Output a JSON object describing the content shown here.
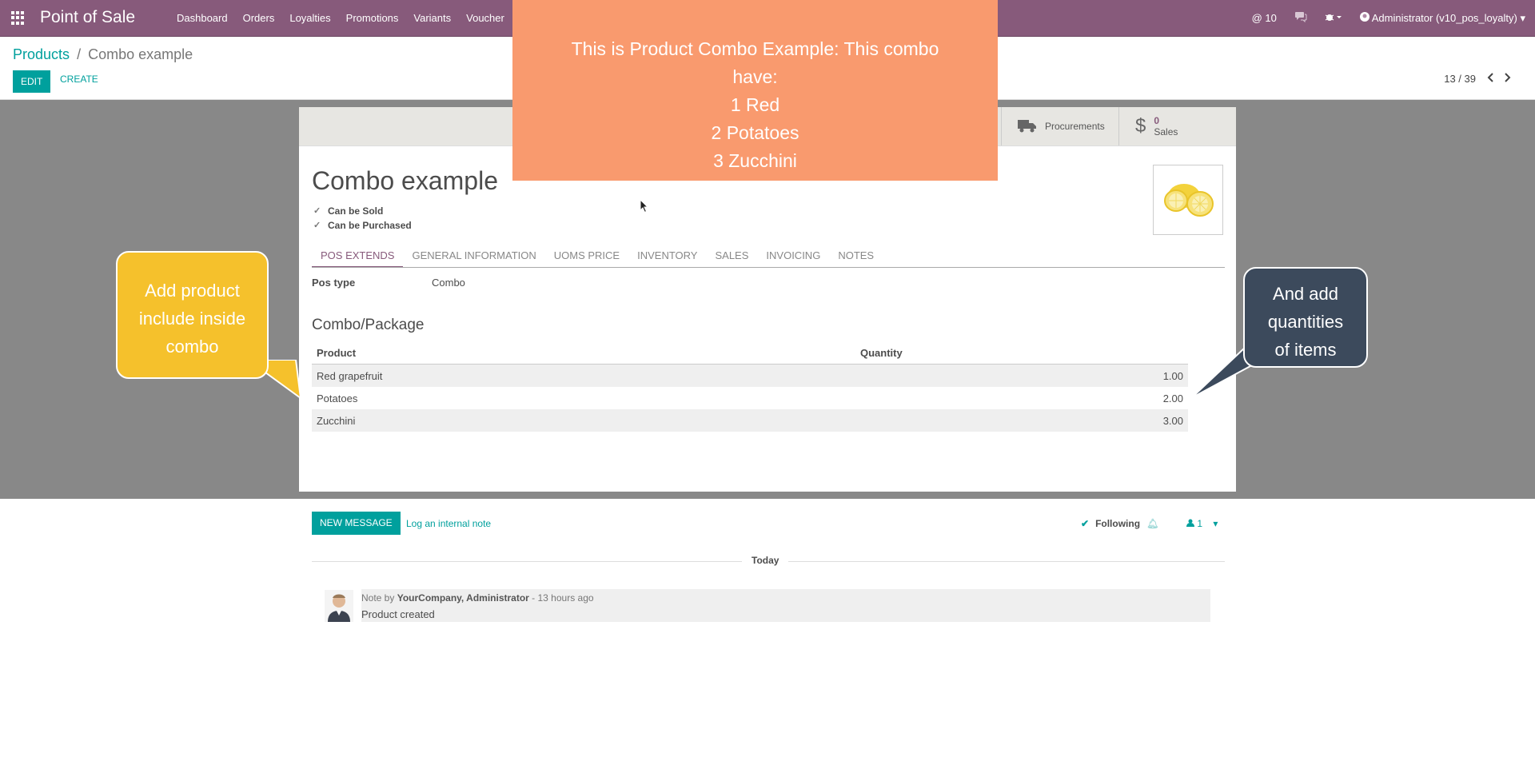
{
  "navbar": {
    "brand": "Point of Sale",
    "menu": [
      "Dashboard",
      "Orders",
      "Loyalties",
      "Promotions",
      "Variants",
      "Voucher"
    ],
    "mentions": "@ 10",
    "user": "Administrator (v10_pos_loyalty)"
  },
  "breadcrumb": {
    "parent": "Products",
    "separator": "/",
    "current": "Combo example"
  },
  "actions": {
    "edit": "EDIT",
    "create": "CREATE"
  },
  "pager": {
    "value": "13 / 39"
  },
  "stat_buttons": {
    "procurements": "Procurements",
    "sales_count": "0",
    "sales_label": "Sales"
  },
  "product": {
    "name": "Combo example",
    "can_be_sold": "Can be Sold",
    "can_be_purchased": "Can be Purchased",
    "image_alt": "lemons"
  },
  "tabs": [
    "POS EXTENDS",
    "GENERAL INFORMATION",
    "UOMS PRICE",
    "INVENTORY",
    "SALES",
    "INVOICING",
    "NOTES"
  ],
  "pos_type": {
    "label": "Pos type",
    "value": "Combo"
  },
  "combo": {
    "title": "Combo/Package",
    "headers": {
      "product": "Product",
      "quantity": "Quantity"
    },
    "rows": [
      {
        "product": "Red grapefruit",
        "quantity": "1.00"
      },
      {
        "product": "Potatoes",
        "quantity": "2.00"
      },
      {
        "product": "Zucchini",
        "quantity": "3.00"
      }
    ]
  },
  "chatter": {
    "new_message": "NEW MESSAGE",
    "log_note": "Log an internal note",
    "following": "Following",
    "followers": "1",
    "today": "Today",
    "message": {
      "prefix": "Note by",
      "author": "YourCompany, Administrator",
      "time": "- 13 hours ago",
      "body": "Product created"
    }
  },
  "callouts": {
    "orange": [
      "This is Product Combo Example: This combo",
      "have:",
      "1 Red",
      "2 Potatoes",
      "3 Zucchini"
    ],
    "yellow": [
      "Add product",
      "include inside",
      "combo"
    ],
    "navy": [
      "And add",
      "quantities",
      "of items"
    ]
  },
  "colors": {
    "navbar": "#875a7b",
    "accent": "#00a09d",
    "callout_orange": "#f99a6e",
    "callout_yellow": "#f5c12c",
    "callout_navy": "#3c4a5c"
  }
}
